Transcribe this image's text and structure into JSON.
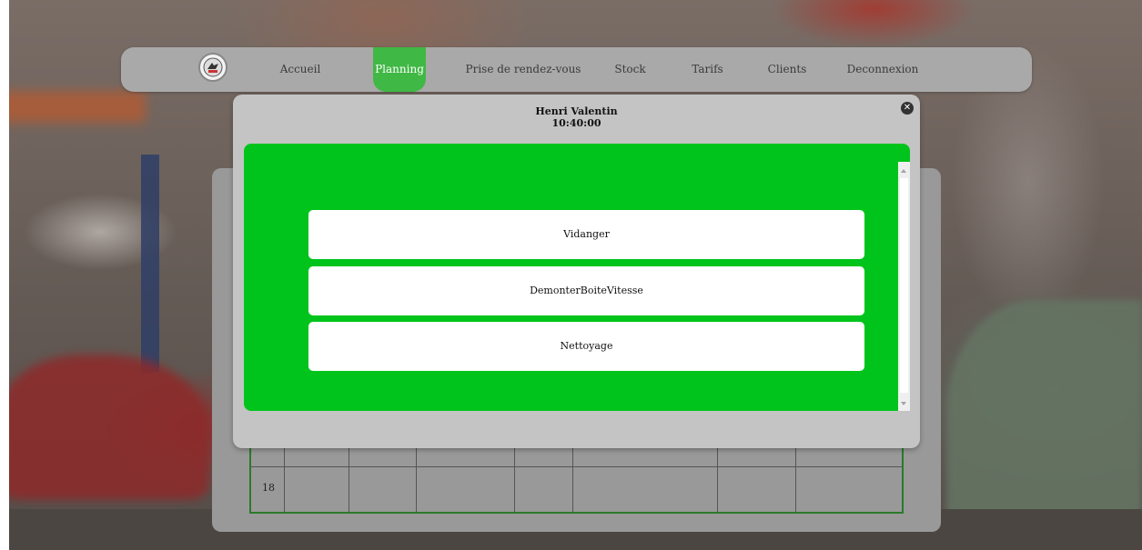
{
  "nav": {
    "items": [
      {
        "label": "Accueil"
      },
      {
        "label": "Planning",
        "active": true
      },
      {
        "label": "Prise de rendez-vous"
      },
      {
        "label": "Stock"
      },
      {
        "label": "Tarifs"
      },
      {
        "label": "Clients"
      },
      {
        "label": "Deconnexion"
      }
    ],
    "active_color": "#40b845"
  },
  "table": {
    "row_label": "18",
    "border_color": "#2a7a2a"
  },
  "modal": {
    "client_name": "Henri Valentin",
    "time": "10:40:00",
    "close_icon": "close-icon",
    "body_color": "#00c41c",
    "tasks": [
      {
        "label": "Vidanger"
      },
      {
        "label": "DemonterBoiteVitesse"
      },
      {
        "label": "Nettoyage"
      }
    ]
  }
}
